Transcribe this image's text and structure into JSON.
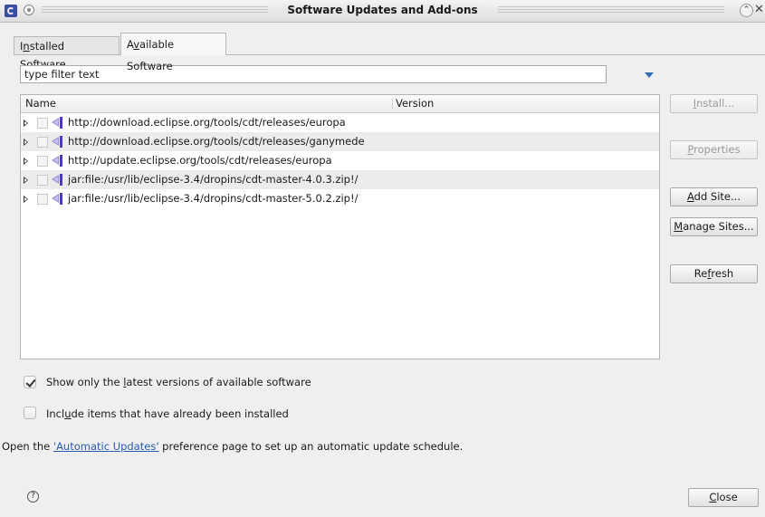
{
  "window": {
    "title": "Software Updates and Add-ons",
    "maximize_glyph": "⌃",
    "close_glyph": "✕"
  },
  "tabs": [
    {
      "pre": "I",
      "key": "n",
      "post": "stalled Software"
    },
    {
      "pre": "A",
      "key": "v",
      "post": "ailable Software"
    }
  ],
  "filter": {
    "value": "type filter text"
  },
  "table": {
    "columns": [
      "Name",
      "Version"
    ],
    "rows": [
      "http://download.eclipse.org/tools/cdt/releases/europa",
      "http://download.eclipse.org/tools/cdt/releases/ganymede",
      "http://update.eclipse.org/tools/cdt/releases/europa",
      "jar:file:/usr/lib/eclipse-3.4/dropins/cdt-master-4.0.3.zip!/",
      "jar:file:/usr/lib/eclipse-3.4/dropins/cdt-master-5.0.2.zip!/"
    ]
  },
  "buttons": {
    "install": {
      "pre": "",
      "key": "I",
      "post": "nstall..."
    },
    "properties": {
      "pre": "",
      "key": "P",
      "post": "roperties"
    },
    "add_site": {
      "pre": "",
      "key": "A",
      "post": "dd Site..."
    },
    "manage_sites": {
      "pre": "",
      "key": "M",
      "post": "anage Sites..."
    },
    "refresh": {
      "pre": "Re",
      "key": "f",
      "post": "resh"
    },
    "close": {
      "pre": "",
      "key": "C",
      "post": "lose"
    }
  },
  "options": {
    "latest": {
      "pre": "Show only the ",
      "key": "l",
      "post": "atest versions of available software",
      "checked": true
    },
    "installed": {
      "pre": "Incl",
      "key": "u",
      "post": "de items that have already been installed",
      "checked": false
    }
  },
  "footer": {
    "prefix": "Open the ",
    "link": "'Automatic Updates'",
    "suffix": " preference page to set up an automatic update schedule."
  },
  "help": {
    "glyph": "?"
  }
}
